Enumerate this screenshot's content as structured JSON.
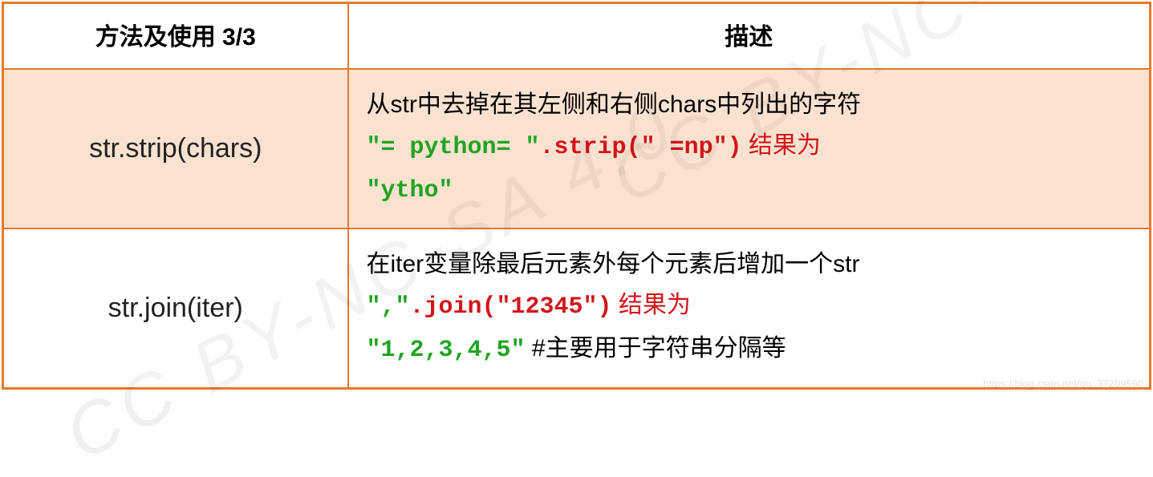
{
  "header": {
    "method": "方法及使用 3/3",
    "desc": "描述"
  },
  "rows": [
    {
      "method": "str.strip(chars)",
      "desc_plain": "从str中去掉在其左侧和右侧chars中列出的字符",
      "code_input": "\"= python= \"",
      "code_call": ".strip(\" =np\")",
      "result_label": " 结果为",
      "code_output": "\"ytho\""
    },
    {
      "method": "str.join(iter)",
      "desc_plain": "在iter变量除最后元素外每个元素后增加一个str",
      "code_input": "\",\"",
      "code_call": ".join(\"12345\")",
      "result_label": " 结果为",
      "code_output": "\"1,2,3,4,5\"",
      "note": "  #主要用于字符串分隔等"
    }
  ],
  "watermark": {
    "big": "CC BY-NC-SA 4.0",
    "small": "https://blog.csdn.net/qq_37209590"
  }
}
